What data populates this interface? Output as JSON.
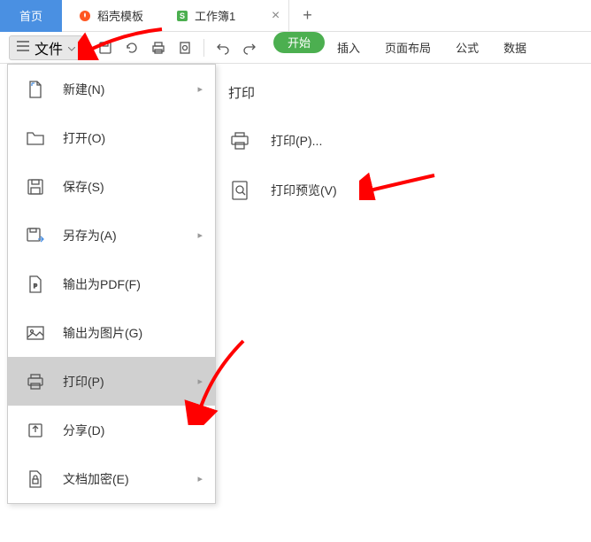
{
  "tabs": {
    "home": "首页",
    "template": "稻壳模板",
    "workbook": "工作簿1"
  },
  "toolbar": {
    "file_label": "文件"
  },
  "ribbon": {
    "start": "开始",
    "insert": "插入",
    "layout": "页面布局",
    "formula": "公式",
    "data": "数据"
  },
  "menu": {
    "new": "新建(N)",
    "open": "打开(O)",
    "save": "保存(S)",
    "saveas": "另存为(A)",
    "exportpdf": "输出为PDF(F)",
    "exportimg": "输出为图片(G)",
    "print": "打印(P)",
    "share": "分享(D)",
    "encrypt": "文档加密(E)"
  },
  "submenu": {
    "title": "打印",
    "print": "打印(P)...",
    "preview": "打印预览(V)"
  }
}
